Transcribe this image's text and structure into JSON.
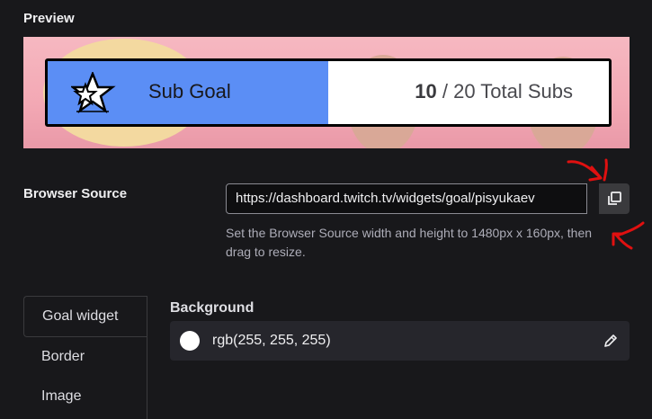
{
  "preview": {
    "title": "Preview",
    "goal_label": "Sub Goal",
    "goal_current": "10",
    "goal_rest": "/ 20 Total Subs",
    "progress": 0.5,
    "fill_color": "#5b8ef5",
    "icon": "star-icon"
  },
  "browser_source": {
    "label": "Browser Source",
    "url": "https://dashboard.twitch.tv/widgets/goal/pisyukaev",
    "copy_icon": "copy-icon",
    "help": "Set the Browser Source width and height to 1480px x 160px, then drag to resize."
  },
  "tabs": [
    {
      "label": "Goal widget",
      "active": true
    },
    {
      "label": "Border",
      "active": false
    },
    {
      "label": "Image",
      "active": false
    }
  ],
  "background": {
    "title": "Background",
    "value": "rgb(255, 255, 255)",
    "swatch_color": "#ffffff",
    "edit_icon": "pencil-icon"
  },
  "annotation_color": "#e01010"
}
